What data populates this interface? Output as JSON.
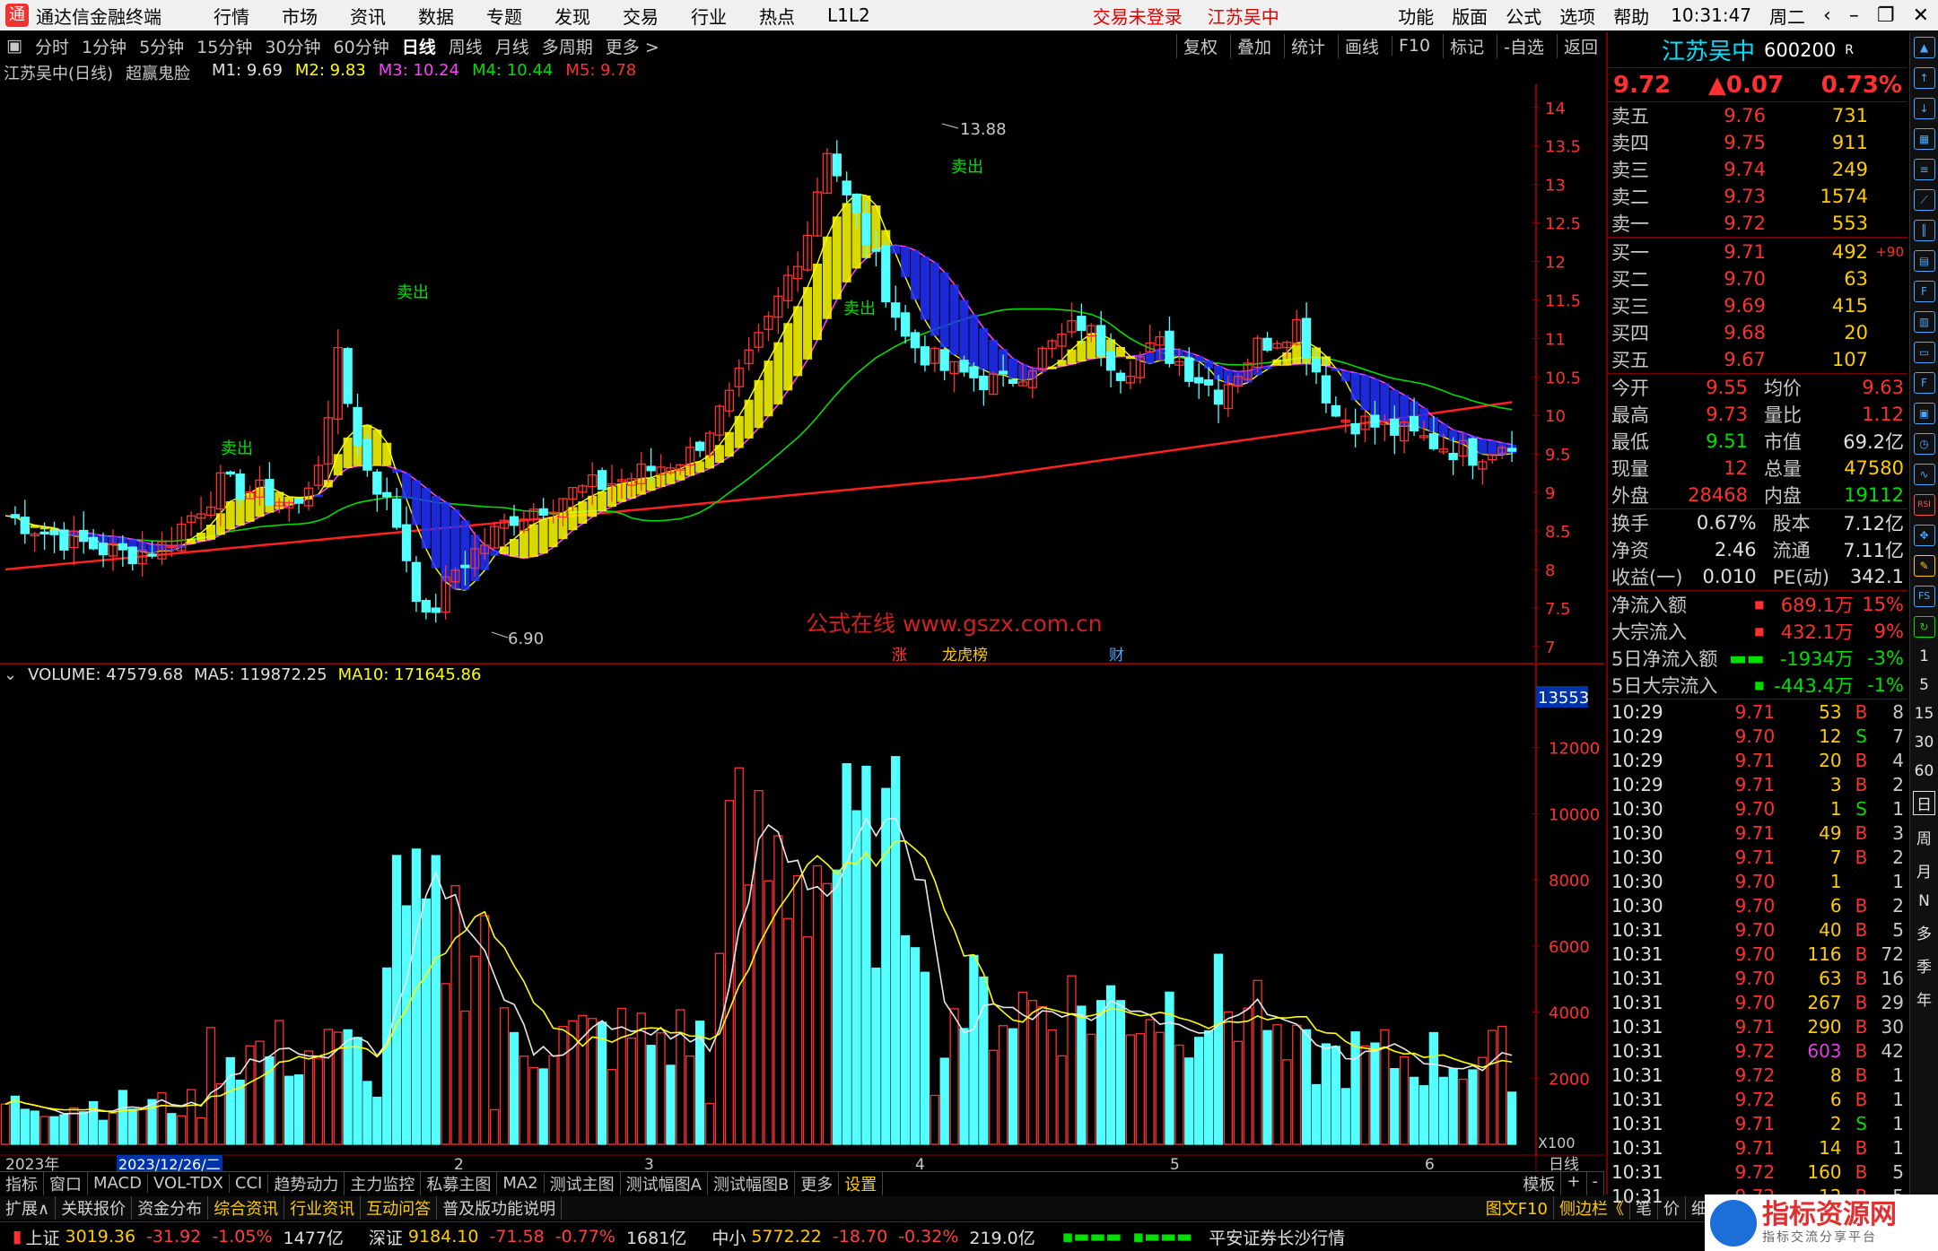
{
  "menubar": {
    "title": "通达信金融终端",
    "items": [
      "行情",
      "市场",
      "资讯",
      "数据",
      "专题",
      "发现",
      "交易",
      "行业",
      "热点",
      "L1L2"
    ],
    "alert1": "交易未登录",
    "alert2": "江苏吴中",
    "right": [
      "功能",
      "版面",
      "公式",
      "选项",
      "帮助"
    ],
    "time": "10:31:47",
    "weekday": "周二"
  },
  "periods": [
    "分时",
    "1分钟",
    "5分钟",
    "15分钟",
    "30分钟",
    "60分钟",
    "日线",
    "周线",
    "月线",
    "多周期",
    "更多 >"
  ],
  "active_period": "日线",
  "tools": [
    "复权",
    "叠加",
    "统计",
    "画线",
    "F10",
    "标记",
    "-自选",
    "返回"
  ],
  "chart_header": {
    "name": "江苏吴中(日线)",
    "formula": "超赢鬼脸",
    "m1": "M1: 9.69",
    "m2": "M2: 9.83",
    "m3": "M3: 10.24",
    "m4": "M4: 10.44",
    "m5": "M5: 9.78"
  },
  "volume_header": {
    "vol": "VOLUME: 47579.68",
    "ma5": "MA5: 119872.25",
    "ma10": "MA10: 171645.86"
  },
  "chart_data": {
    "type": "candlestick",
    "price_axis": [
      14.0,
      13.5,
      13.0,
      12.5,
      12.0,
      11.5,
      11.0,
      10.5,
      10.0,
      9.5,
      9.0,
      8.5,
      8.0,
      7.5,
      7.0
    ],
    "ylim": [
      6.8,
      14.3
    ],
    "high_label": "13.88",
    "low_label": "6.90",
    "signal_label": "卖出",
    "watermark": "公式在线 www.gszx.com.cn",
    "event_labels": [
      "涨",
      "龙虎榜",
      "财"
    ],
    "volume_axis": [
      "12000",
      "10000",
      "8000",
      "6000",
      "4000",
      "2000"
    ],
    "volume_top": "13553",
    "volume_unit": "X100",
    "x_labels": [
      "2023年",
      "2023/12/26/二",
      "2",
      "3",
      "4",
      "5",
      "6"
    ],
    "period_label": "日线",
    "colors": {
      "up": "#ff3232",
      "down": "#54ffff",
      "ma_yellow": "#ffff00",
      "ma_magenta": "#ff40ff",
      "ma_green": "#00dd00",
      "ma_red": "#ff2020",
      "ribbon_blue": "#2030ff"
    }
  },
  "ind_tabs": [
    "指标",
    "窗口",
    "MACD",
    "VOL-TDX",
    "CCI",
    "趋势动力",
    "主力监控",
    "私募主图",
    "MA2",
    "测试主图",
    "测试幅图A",
    "测试幅图B",
    "更多",
    "设置"
  ],
  "ind_tabs_right": [
    "模板",
    "+",
    "-"
  ],
  "info_tabs": [
    "扩展∧",
    "关联报价",
    "资金分布",
    "综合资讯",
    "行业资讯",
    "互动问答",
    "普及版功能说明"
  ],
  "info_tabs_right": [
    "图文F10",
    "侧边栏《",
    "笔",
    "价",
    "细"
  ],
  "status": {
    "sh_label": "上证",
    "sh_val": "3019.36",
    "sh_chg": "-31.92",
    "sh_pct": "-1.05%",
    "sh_amt": "1477亿",
    "sz_label": "深证",
    "sz_val": "9184.10",
    "sz_chg": "-71.58",
    "sz_pct": "-0.77%",
    "sz_amt": "1681亿",
    "zx_label": "中小",
    "zx_val": "5772.22",
    "zx_chg": "-18.70",
    "zx_pct": "-0.32%",
    "zx_amt": "219.0亿",
    "broker": "平安证券长沙行情"
  },
  "quote": {
    "name": "江苏吴中",
    "code": "600200",
    "flag": "R",
    "price": "9.72",
    "change": "▲0.07",
    "pct": "0.73%",
    "sells": [
      [
        "卖五",
        "9.76",
        "731"
      ],
      [
        "卖四",
        "9.75",
        "911"
      ],
      [
        "卖三",
        "9.74",
        "249"
      ],
      [
        "卖二",
        "9.73",
        "1574"
      ],
      [
        "卖一",
        "9.72",
        "553"
      ]
    ],
    "buys": [
      [
        "买一",
        "9.71",
        "492",
        "+90"
      ],
      [
        "买二",
        "9.70",
        "63",
        ""
      ],
      [
        "买三",
        "9.69",
        "415",
        ""
      ],
      [
        "买四",
        "9.68",
        "20",
        ""
      ],
      [
        "买五",
        "9.67",
        "107",
        ""
      ]
    ],
    "stats": [
      [
        "今开",
        "9.55",
        "均价",
        "9.63"
      ],
      [
        "最高",
        "9.73",
        "量比",
        "1.12"
      ],
      [
        "最低",
        "9.51",
        "市值",
        "69.2亿"
      ],
      [
        "现量",
        "12",
        "总量",
        "47580"
      ],
      [
        "外盘",
        "28468",
        "内盘",
        "19112"
      ],
      [
        "换手",
        "0.67%",
        "股本",
        "7.12亿"
      ],
      [
        "净资",
        "2.46",
        "流通",
        "7.11亿"
      ],
      [
        "收益(一)",
        "0.010",
        "PE(动)",
        "342.1"
      ]
    ],
    "flows": [
      [
        "净流入额",
        "689.1万",
        "15%"
      ],
      [
        "大宗流入",
        "432.1万",
        "9%"
      ],
      [
        "5日净流入额",
        "-1934万",
        "-3%"
      ],
      [
        "5日大宗流入",
        "-443.4万",
        "-1%"
      ]
    ],
    "ticks": [
      [
        "10:29",
        "9.71",
        "53",
        "B",
        "8"
      ],
      [
        "10:29",
        "9.70",
        "12",
        "S",
        "7"
      ],
      [
        "10:29",
        "9.71",
        "20",
        "B",
        "4"
      ],
      [
        "10:29",
        "9.71",
        "3",
        "B",
        "2"
      ],
      [
        "10:30",
        "9.70",
        "1",
        "S",
        "1"
      ],
      [
        "10:30",
        "9.71",
        "49",
        "B",
        "3"
      ],
      [
        "10:30",
        "9.71",
        "7",
        "B",
        "2"
      ],
      [
        "10:30",
        "9.70",
        "1",
        "",
        "1"
      ],
      [
        "10:30",
        "9.70",
        "6",
        "B",
        "2"
      ],
      [
        "10:31",
        "9.70",
        "40",
        "B",
        "5"
      ],
      [
        "10:31",
        "9.70",
        "116",
        "B",
        "72"
      ],
      [
        "10:31",
        "9.70",
        "63",
        "B",
        "16"
      ],
      [
        "10:31",
        "9.70",
        "267",
        "B",
        "29"
      ],
      [
        "10:31",
        "9.71",
        "290",
        "B",
        "30"
      ],
      [
        "10:31",
        "9.72",
        "603",
        "B",
        "42"
      ],
      [
        "10:31",
        "9.72",
        "8",
        "B",
        "1"
      ],
      [
        "10:31",
        "9.72",
        "6",
        "B",
        "1"
      ],
      [
        "10:31",
        "9.71",
        "2",
        "S",
        "1"
      ],
      [
        "10:31",
        "9.71",
        "14",
        "B",
        "1"
      ],
      [
        "10:31",
        "9.72",
        "160",
        "B",
        "5"
      ],
      [
        "10:31",
        "9.72",
        "12",
        "B",
        "5"
      ]
    ]
  },
  "sidebar_periods": [
    "1",
    "5",
    "15",
    "30",
    "60",
    "日",
    "周",
    "月",
    "N",
    "多",
    "季",
    "年"
  ],
  "sidebar_icons": [
    "RSI",
    "FS"
  ],
  "watermark": {
    "title": "指标资源网",
    "sub": "指标交流分享平台"
  }
}
